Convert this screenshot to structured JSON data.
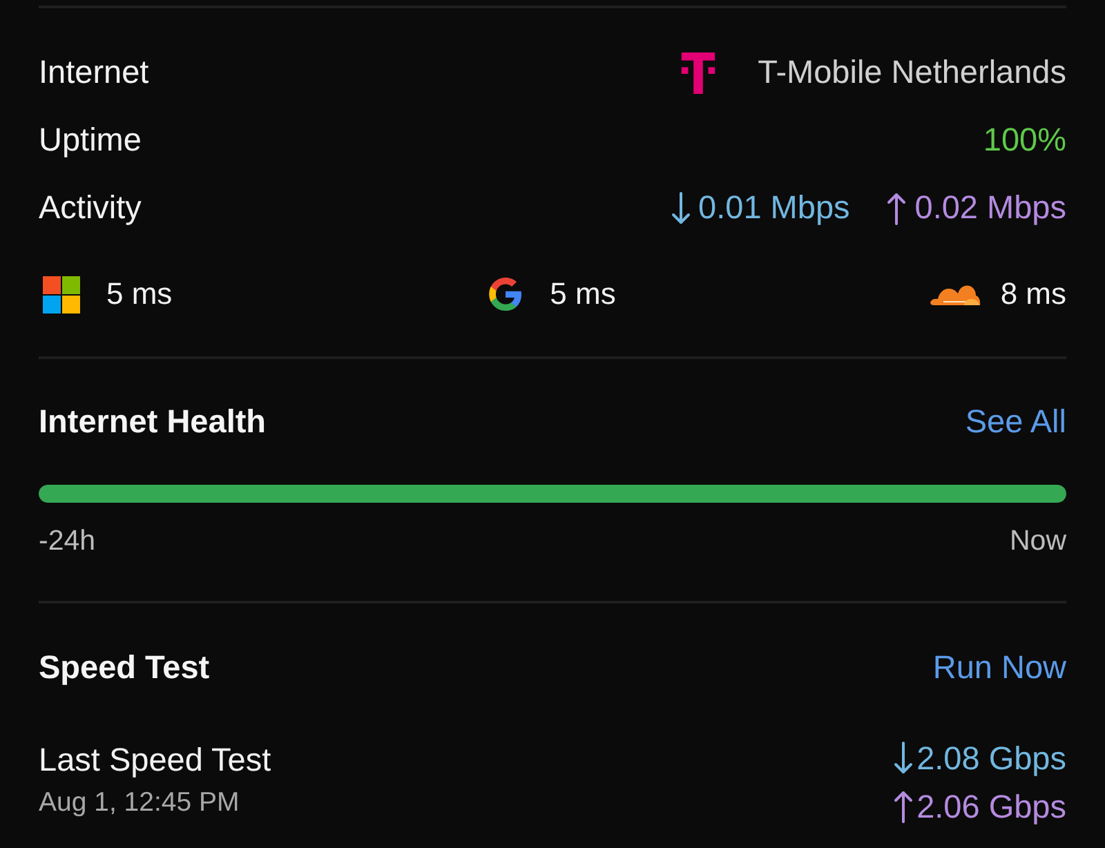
{
  "info_rows": [
    {
      "kind": "provider",
      "label": "Internet",
      "value": "T-Mobile Netherlands"
    },
    {
      "kind": "uptime",
      "label": "Uptime",
      "value": "100%"
    },
    {
      "kind": "activity",
      "label": "Activity",
      "rates": [
        {
          "kind": "down",
          "value": "0.01 Mbps"
        },
        {
          "kind": "up",
          "value": "0.02 Mbps"
        }
      ]
    }
  ],
  "latency": [
    {
      "kind": "squares",
      "value": "5 ms"
    },
    {
      "kind": "g-mark",
      "value": "5 ms"
    },
    {
      "kind": "cloud",
      "value": "8 ms"
    }
  ],
  "internet_health": {
    "title": "Internet Health",
    "action": "See All",
    "level": 1,
    "start_label": "-24h",
    "end_label": "Now"
  },
  "speed_test": {
    "title": "Speed Test",
    "action": "Run Now",
    "last_label": "Last Speed Test",
    "last_time": "Aug 1, 12:45 PM",
    "results": [
      {
        "kind": "down",
        "value": "2.08 Gbps"
      },
      {
        "kind": "up",
        "value": "2.06 Gbps"
      }
    ]
  }
}
